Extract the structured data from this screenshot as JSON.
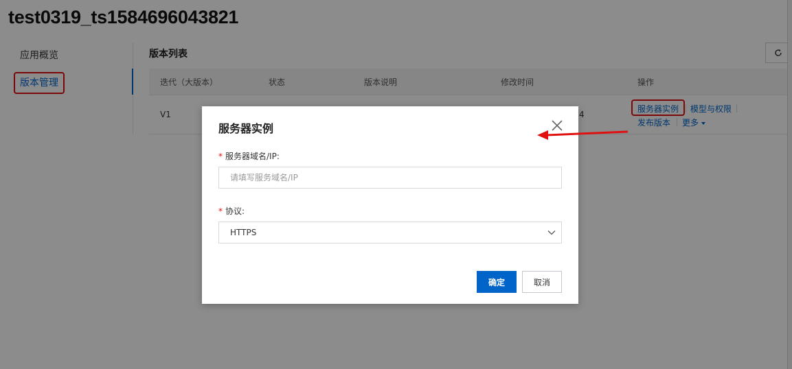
{
  "app": {
    "title": "test0319_ts1584696043821"
  },
  "sidebar": {
    "items": [
      {
        "label": "应用概览",
        "active": false
      },
      {
        "label": "版本管理",
        "active": true
      }
    ]
  },
  "main": {
    "section_title": "版本列表",
    "refresh_icon": "refresh-icon",
    "table": {
      "columns": [
        "迭代（大版本）",
        "状态",
        "版本说明",
        "修改时间",
        "操作"
      ],
      "rows": [
        {
          "iteration": "V1",
          "modified_partial": "4",
          "actions": [
            "服务器实例",
            "模型与权限",
            "发布版本",
            "更多"
          ]
        }
      ]
    }
  },
  "modal": {
    "title": "服务器实例",
    "fields": {
      "host": {
        "label": "服务器域名/IP:",
        "required_mark": "*",
        "placeholder": "请填写服务域名/IP",
        "value": ""
      },
      "protocol": {
        "label": "协议:",
        "required_mark": "*",
        "selected": "HTTPS"
      }
    },
    "buttons": {
      "confirm": "确定",
      "cancel": "取消"
    },
    "close_icon": "close-icon"
  },
  "colors": {
    "accent": "#0064c8",
    "annotation": "#e01010",
    "overlay": "rgba(0,0,0,0.45)"
  }
}
